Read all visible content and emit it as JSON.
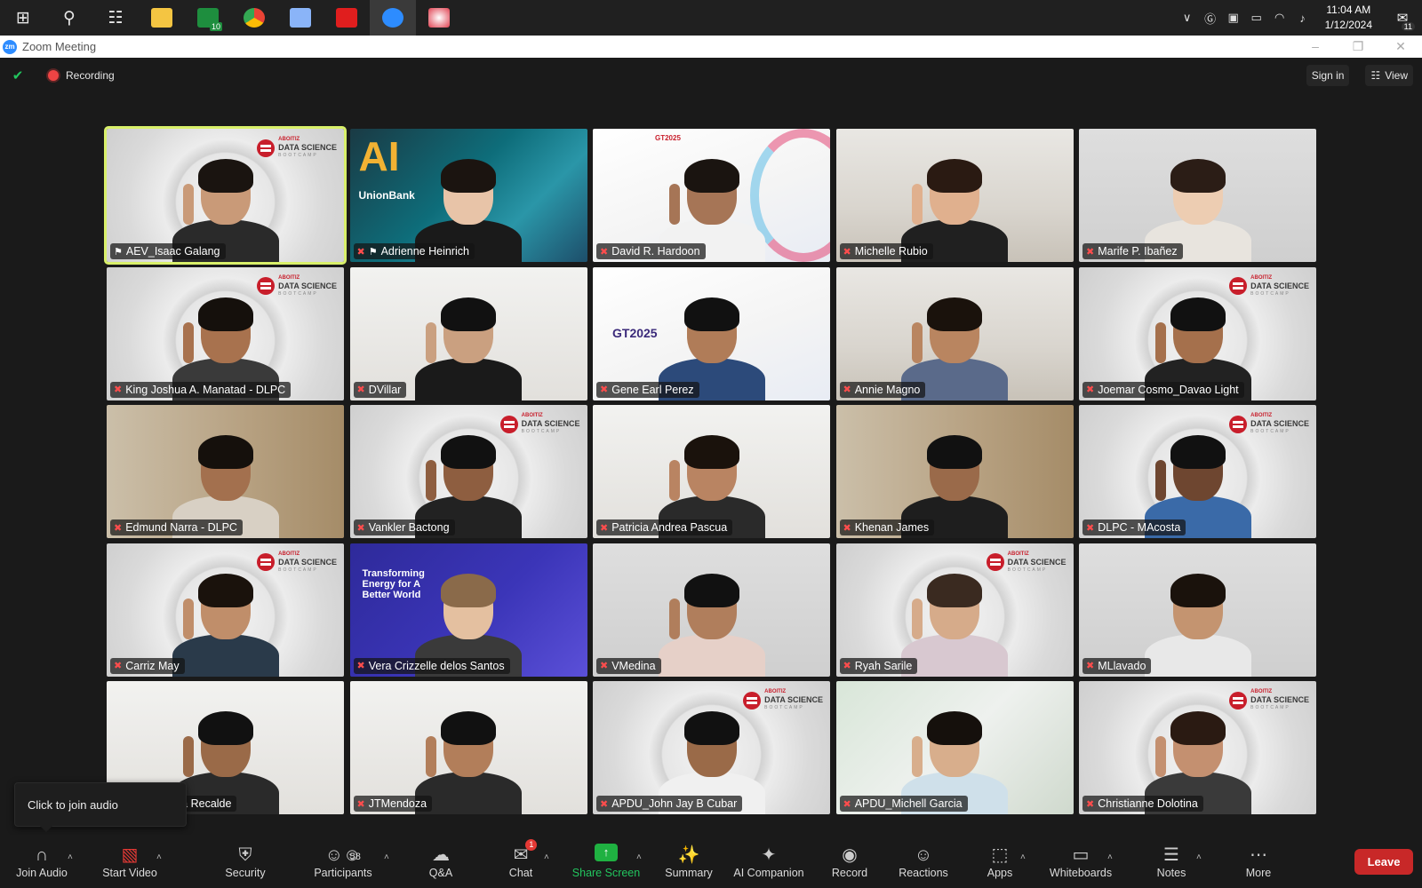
{
  "taskbar": {
    "time": "11:04 AM",
    "date": "1/12/2024",
    "notification_count": "11",
    "app_badge": "10"
  },
  "window": {
    "title": "Zoom Meeting"
  },
  "top": {
    "recording_label": "Recording",
    "sign_in": "Sign in",
    "view": "View"
  },
  "tiles": [
    {
      "name": "AEV_Isaac Galang",
      "bg": "abz",
      "logo": true,
      "speaking": true,
      "pin": true,
      "mic": false,
      "skin": "#c99a78",
      "shirt": "#2a2a2a",
      "hair": "#1a1410"
    },
    {
      "name": "Adrienne Heinrich",
      "bg": "ub",
      "logo": false,
      "mic": true,
      "pin": true,
      "skin": "#e8c4a8",
      "shirt": "#1a1a1a",
      "hair": "#1b1410"
    },
    {
      "name": "David R. Hardoon",
      "bg": "gt",
      "logo": false,
      "mic": true,
      "skin": "#a67556",
      "shirt": "#f2f2f2",
      "hair": "#1a1410"
    },
    {
      "name": "Michelle Rubio",
      "bg": "room",
      "logo": false,
      "mic": true,
      "skin": "#e0b08e",
      "shirt": "#202020",
      "hair": "#2a1a12"
    },
    {
      "name": "Marife P. Ibañez",
      "bg": "wall",
      "logo": false,
      "mic": true,
      "skin": "#edcdb2",
      "shirt": "#e8e4de",
      "hair": "#2b1d16"
    },
    {
      "name": "King Joshua A. Manatad - DLPC",
      "bg": "abz",
      "logo": true,
      "mic": true,
      "skin": "#a8724e",
      "shirt": "#3a3a3a",
      "hair": "#15100c"
    },
    {
      "name": "DVillar",
      "bg": "office",
      "logo": false,
      "mic": true,
      "skin": "#caa080",
      "shirt": "#1a1a1a",
      "hair": "#111"
    },
    {
      "name": "Gene Earl Perez",
      "bg": "gt2",
      "logo": false,
      "mic": true,
      "skin": "#b07c58",
      "shirt": "#2c4a7a",
      "hair": "#111"
    },
    {
      "name": "Annie Magno",
      "bg": "room",
      "logo": false,
      "mic": true,
      "skin": "#b98560",
      "shirt": "#5a6a8a",
      "hair": "#1a120c"
    },
    {
      "name": "Joemar Cosmo_Davao Light",
      "bg": "abz",
      "logo": true,
      "mic": true,
      "skin": "#a5704c",
      "shirt": "#222",
      "hair": "#111"
    },
    {
      "name": "Edmund Narra - DLPC",
      "bg": "wood",
      "logo": false,
      "mic": true,
      "skin": "#a3704e",
      "shirt": "#d8d0c4",
      "hair": "#15100c"
    },
    {
      "name": "Vankler Bactong",
      "bg": "abz",
      "logo": true,
      "mic": true,
      "skin": "#8e5e40",
      "shirt": "#222",
      "hair": "#111"
    },
    {
      "name": "Patricia Andrea Pascua",
      "bg": "office",
      "logo": false,
      "mic": true,
      "skin": "#b98462",
      "shirt": "#2a2a2a",
      "hair": "#1a120c"
    },
    {
      "name": "Khenan James",
      "bg": "wood",
      "logo": false,
      "mic": true,
      "skin": "#9a6a4a",
      "shirt": "#1e1e1e",
      "hair": "#111"
    },
    {
      "name": "DLPC - MAcosta",
      "bg": "abz",
      "logo": true,
      "mic": true,
      "skin": "#6e4630",
      "shirt": "#3a6aa8",
      "hair": "#111"
    },
    {
      "name": "Carriz May",
      "bg": "abz",
      "logo": true,
      "mic": true,
      "skin": "#c08e6a",
      "shirt": "#2a3a4a",
      "hair": "#1a120c"
    },
    {
      "name": "Vera Crizzelle delos Santos",
      "bg": "blue",
      "logo": false,
      "mic": true,
      "skin": "#e4c0a0",
      "shirt": "#3a3a3a",
      "hair": "#8a6a4a"
    },
    {
      "name": "VMedina",
      "bg": "wall",
      "logo": false,
      "mic": true,
      "skin": "#b07e5c",
      "shirt": "#e6d0c8",
      "hair": "#111"
    },
    {
      "name": "Ryah Sarile",
      "bg": "abz",
      "logo": true,
      "mic": true,
      "skin": "#d6ab8a",
      "shirt": "#d8c8d0",
      "hair": "#3a2a20"
    },
    {
      "name": "MLlavado",
      "bg": "wall",
      "logo": false,
      "mic": true,
      "skin": "#c49470",
      "shirt": "#e8e8e8",
      "hair": "#1a120c"
    },
    {
      "name": "er -  ISG | Karla Recalde",
      "bg": "office",
      "logo": false,
      "mic": false,
      "skin": "#9a6a48",
      "shirt": "#2a2a2a",
      "hair": "#111"
    },
    {
      "name": "JTMendoza",
      "bg": "office",
      "logo": false,
      "mic": true,
      "skin": "#b27e5a",
      "shirt": "#2a2a2a",
      "hair": "#111"
    },
    {
      "name": "APDU_John Jay B Cubar",
      "bg": "abz",
      "logo": true,
      "mic": true,
      "skin": "#9a6a48",
      "shirt": "#f0f0f0",
      "hair": "#111"
    },
    {
      "name": "APDU_Michell Garcia",
      "bg": "green",
      "logo": false,
      "mic": true,
      "skin": "#d8ae8c",
      "shirt": "#cfe0ea",
      "hair": "#15100c"
    },
    {
      "name": "Christianne Dolotina",
      "bg": "abz",
      "logo": true,
      "mic": true,
      "skin": "#c49070",
      "shirt": "#3a3a3a",
      "hair": "#2a1a12"
    }
  ],
  "logo_text": {
    "line1": "ABOITIZ",
    "line2": "DATA SCIENCE",
    "line3": "BOOTCAMP"
  },
  "tile_text": {
    "ub_big": "AI",
    "ub_brand": "UnionBank",
    "gt": "GT2025",
    "energy": "Transforming Energy for A Better World"
  },
  "tooltip": "Click to join audio",
  "toolbar": {
    "join_audio": "Join Audio",
    "start_video": "Start Video",
    "security": "Security",
    "participants": "Participants",
    "participant_count": "58",
    "qa": "Q&A",
    "chat": "Chat",
    "chat_badge": "1",
    "share_screen": "Share Screen",
    "summary": "Summary",
    "ai_companion": "AI Companion",
    "record": "Record",
    "reactions": "Reactions",
    "apps": "Apps",
    "whiteboards": "Whiteboards",
    "notes": "Notes",
    "more": "More",
    "leave": "Leave"
  },
  "colors": {
    "speaking_outline": "#d9f06a",
    "leave_red": "#c82828",
    "share_green": "#1fb141",
    "recording_red": "#ef4444"
  }
}
